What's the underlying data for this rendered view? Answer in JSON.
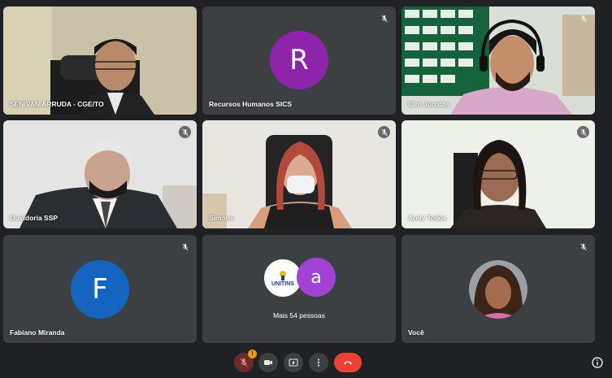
{
  "participants": [
    {
      "name": "SENIVAN ARRUDA - CGE/TO"
    },
    {
      "name": "Recursos Humanos SICS",
      "initial": "R",
      "avatar_color": "#8e24aa"
    },
    {
      "name": "Ciro Jonatas"
    },
    {
      "name": "Ouvidoria SSP"
    },
    {
      "name": "Simone"
    },
    {
      "name": "Arely Tolkis"
    },
    {
      "name": "Fabiano Miranda",
      "initial": "F",
      "avatar_color": "#1565c0"
    },
    {
      "name": "Mais 54 pessoas",
      "logo_text": "UNITINS",
      "initial": "a",
      "avatar_color": "#a142d4"
    },
    {
      "name": "Você"
    }
  ],
  "toolbar": {
    "mic_badge": "!"
  },
  "colors": {
    "tile_bg": "#3c4043",
    "page_bg": "#202124",
    "end_call": "#ea4335"
  },
  "icons": [
    "mic-off-icon",
    "camera-icon",
    "present-screen-icon",
    "more-options-icon",
    "end-call-icon",
    "info-icon"
  ]
}
